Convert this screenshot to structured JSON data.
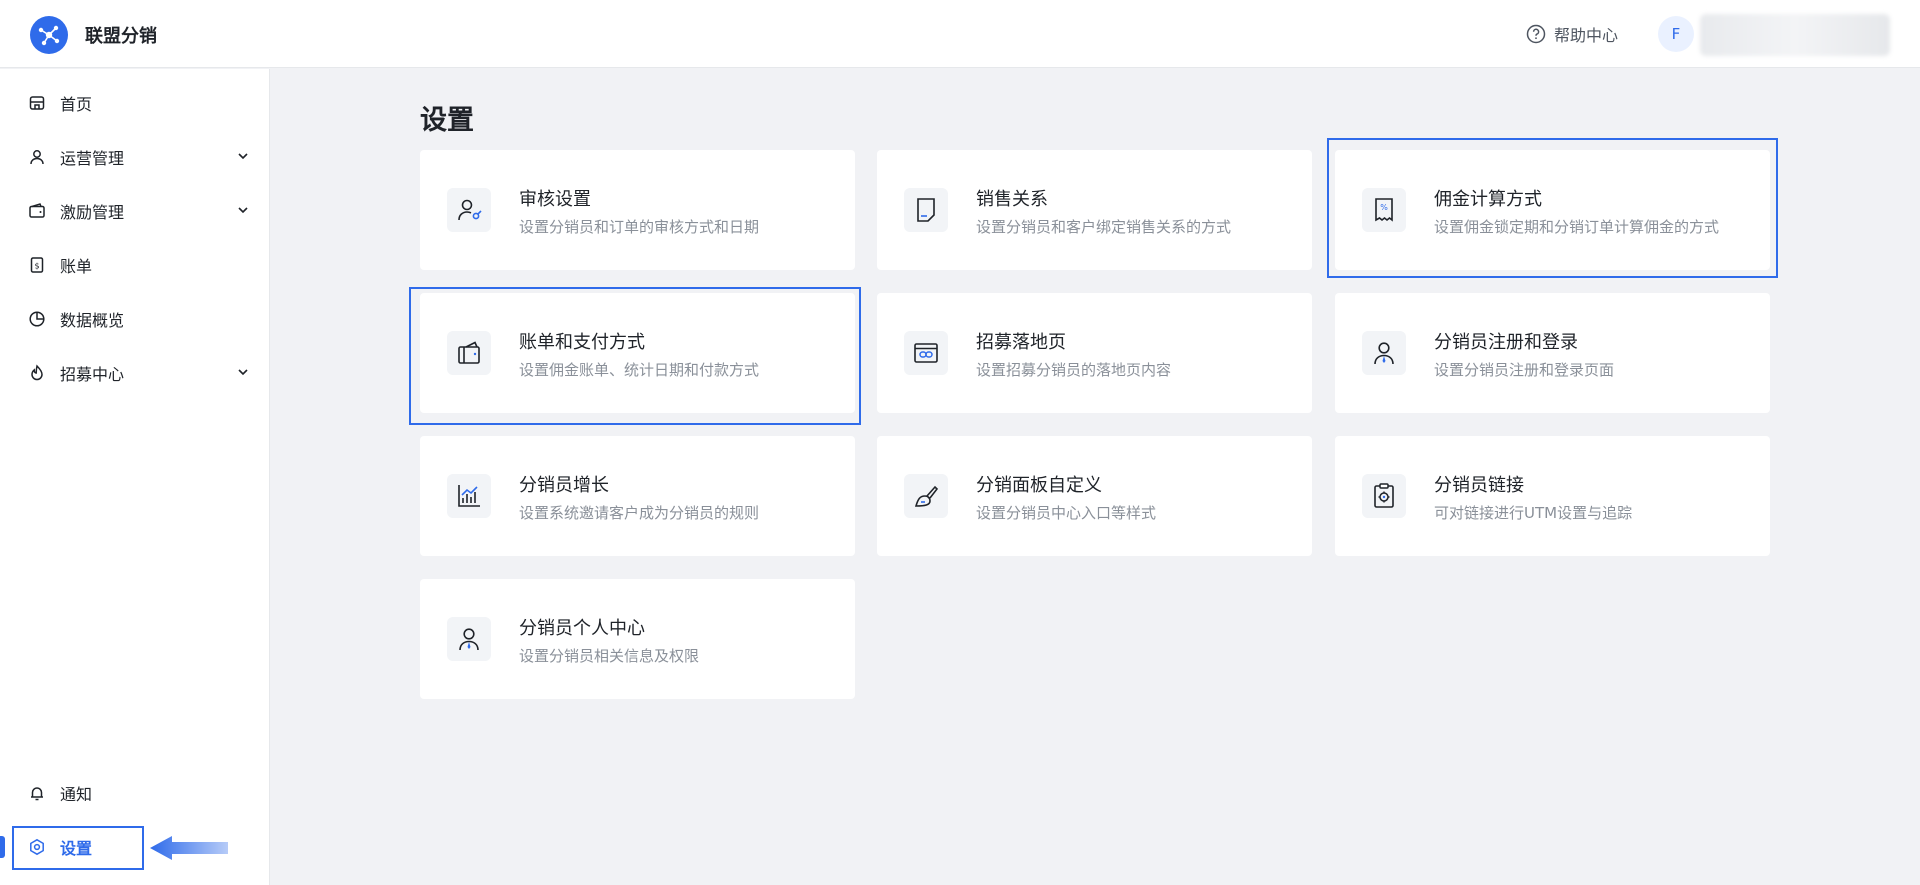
{
  "header": {
    "brand": "联盟分销",
    "help_label": "帮助中心",
    "avatar_letter": "F"
  },
  "sidebar": {
    "items": [
      {
        "label": "首页",
        "icon": "store-icon"
      },
      {
        "label": "运营管理",
        "icon": "user-icon",
        "expandable": true
      },
      {
        "label": "激励管理",
        "icon": "wallet-icon",
        "expandable": true
      },
      {
        "label": "账单",
        "icon": "bill-icon"
      },
      {
        "label": "数据概览",
        "icon": "pie-chart-icon"
      },
      {
        "label": "招募中心",
        "icon": "flame-icon",
        "expandable": true
      }
    ],
    "bottom": [
      {
        "label": "通知",
        "icon": "bell-icon"
      },
      {
        "label": "设置",
        "icon": "settings-hex-icon",
        "active": true
      }
    ]
  },
  "main": {
    "title": "设置",
    "cards": [
      {
        "title": "审核设置",
        "desc": "设置分销员和订单的审核方式和日期",
        "icon": "user-review-icon"
      },
      {
        "title": "销售关系",
        "desc": "设置分销员和客户绑定销售关系的方式",
        "icon": "document-icon"
      },
      {
        "title": "佣金计算方式",
        "desc": "设置佣金锁定期和分销订单计算佣金的方式",
        "icon": "receipt-percent-icon"
      },
      {
        "title": "账单和支付方式",
        "desc": "设置佣金账单、统计日期和付款方式",
        "icon": "wallet-card-icon"
      },
      {
        "title": "招募落地页",
        "desc": "设置招募分销员的落地页内容",
        "icon": "browser-link-icon"
      },
      {
        "title": "分销员注册和登录",
        "desc": "设置分销员注册和登录页面",
        "icon": "person-tie-icon"
      },
      {
        "title": "分销员增长",
        "desc": "设置系统邀请客户成为分销员的规则",
        "icon": "growth-chart-icon"
      },
      {
        "title": "分销面板自定义",
        "desc": "设置分销员中心入口等样式",
        "icon": "paint-brush-icon"
      },
      {
        "title": "分销员链接",
        "desc": "可对链接进行UTM设置与追踪",
        "icon": "clipboard-target-icon"
      },
      {
        "title": "分销员个人中心",
        "desc": "设置分销员相关信息及权限",
        "icon": "person-tie-icon"
      }
    ]
  },
  "colors": {
    "accent": "#2f6bea",
    "background": "#f1f2f5",
    "muted_text": "#8a9099"
  }
}
